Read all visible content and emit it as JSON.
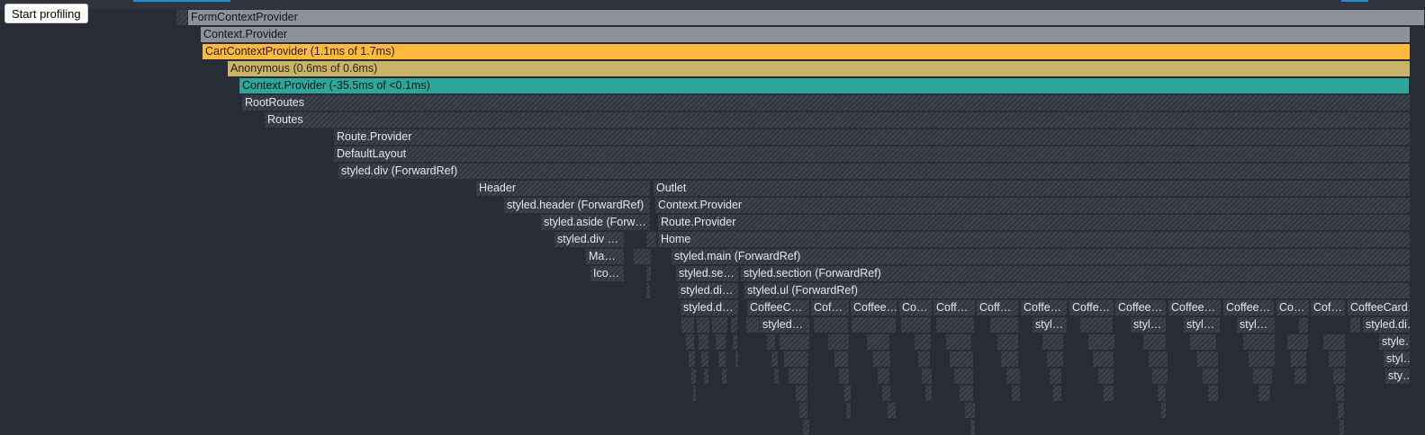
{
  "toolbar": {
    "start_label": "Start profiling"
  },
  "colors": {
    "background": "#282c34",
    "gray_bar": "#8e919a",
    "yellow_bar": "#ffba3d",
    "olive_bar": "#cbb468",
    "teal_bar": "#2ea79a",
    "accent_blue": "#1e8fd6"
  },
  "flame": {
    "nodes": [
      {
        "label": "FormContextProvider",
        "style": "gray"
      },
      {
        "label": "Context.Provider",
        "style": "gray"
      },
      {
        "label": "CartContextProvider (1.1ms of 1.7ms)",
        "style": "yellow"
      },
      {
        "label": "Anonymous (0.6ms of 0.6ms)",
        "style": "olive"
      },
      {
        "label": "Context.Provider (-35.5ms of <0.1ms)",
        "style": "teal"
      },
      {
        "label": "RootRoutes",
        "style": "hatch"
      },
      {
        "label": "Routes",
        "style": "hatch"
      },
      {
        "label": "Route.Provider",
        "style": "hatch"
      },
      {
        "label": "DefaultLayout",
        "style": "hatch"
      },
      {
        "label": "styled.div (ForwardRef)",
        "style": "hatch"
      },
      {
        "label": "Header",
        "style": "hatch"
      },
      {
        "label": "Outlet",
        "style": "hatch"
      },
      {
        "label": "styled.header (ForwardRef)",
        "style": "hatch"
      },
      {
        "label": "Context.Provider",
        "style": "hatch"
      },
      {
        "label": "styled.aside (Forw…",
        "style": "hatch"
      },
      {
        "label": "Route.Provider",
        "style": "hatch"
      },
      {
        "label": "styled.div …",
        "style": "hatch"
      },
      {
        "label": "Home",
        "style": "hatch"
      },
      {
        "label": "Ma…",
        "style": "hatch"
      },
      {
        "label": "styled.main (ForwardRef)",
        "style": "hatch"
      },
      {
        "label": "Ico…",
        "style": "hatch"
      },
      {
        "label": "styled.se…",
        "style": "hatch"
      },
      {
        "label": "styled.section (ForwardRef)",
        "style": "hatch"
      },
      {
        "label": "styled.di…",
        "style": "hatch"
      },
      {
        "label": "styled.ul (ForwardRef)",
        "style": "hatch"
      },
      {
        "label": "styled.d…",
        "style": "hatch"
      },
      {
        "label": "CoffeeC…",
        "style": "hatch"
      },
      {
        "label": "Cof…",
        "style": "hatch"
      },
      {
        "label": "Coffee…",
        "style": "hatch"
      },
      {
        "label": "Co…",
        "style": "hatch"
      },
      {
        "label": "Coff…",
        "style": "hatch"
      },
      {
        "label": "Coff…",
        "style": "hatch"
      },
      {
        "label": "Coffe…",
        "style": "hatch"
      },
      {
        "label": "Coffe…",
        "style": "hatch"
      },
      {
        "label": "Coffee…",
        "style": "hatch"
      },
      {
        "label": "Coffee…",
        "style": "hatch"
      },
      {
        "label": "Coffee…",
        "style": "hatch"
      },
      {
        "label": "Co…",
        "style": "hatch"
      },
      {
        "label": "Cof…",
        "style": "hatch"
      },
      {
        "label": "CoffeeCard…",
        "style": "hatch"
      },
      {
        "label": "styled…",
        "style": "hatch"
      },
      {
        "label": "styl…",
        "style": "hatch"
      },
      {
        "label": "styl…",
        "style": "hatch"
      },
      {
        "label": "styl…",
        "style": "hatch"
      },
      {
        "label": "styl…",
        "style": "hatch"
      },
      {
        "label": "styled.di…",
        "style": "hatch"
      },
      {
        "label": "style…",
        "style": "hatch"
      },
      {
        "label": "styl…",
        "style": "hatch"
      },
      {
        "label": "sty…",
        "style": "hatch"
      }
    ]
  }
}
